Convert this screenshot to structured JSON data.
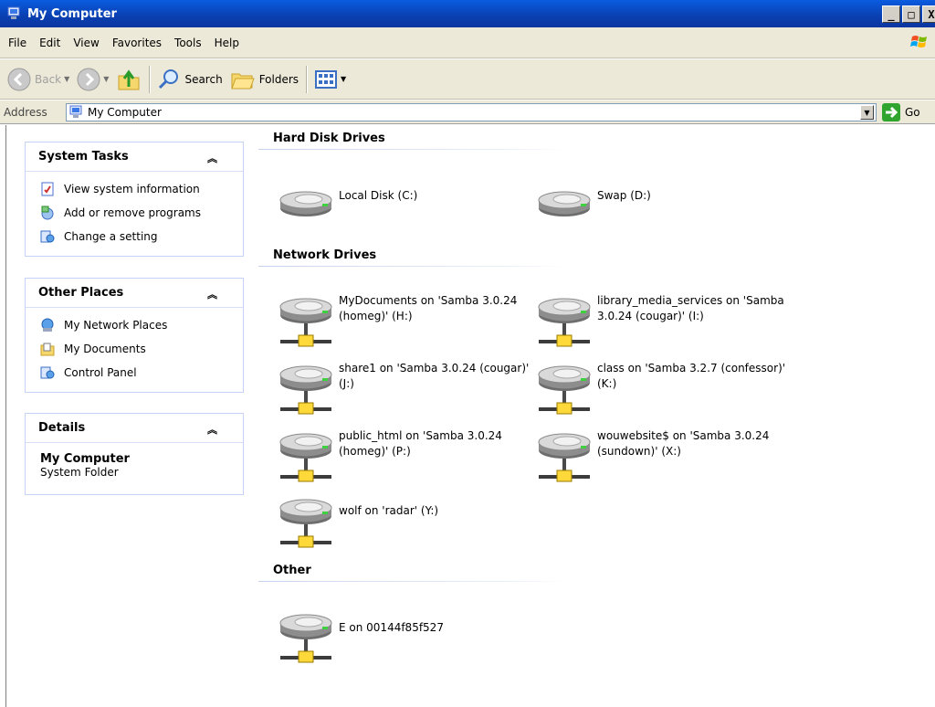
{
  "window": {
    "title": "My Computer",
    "buttons": [
      "_",
      "□",
      "X"
    ]
  },
  "menu": [
    "File",
    "Edit",
    "View",
    "Favorites",
    "Tools",
    "Help"
  ],
  "toolbar": {
    "back_label": "Back",
    "search_label": "Search",
    "folders_label": "Folders"
  },
  "address": {
    "label": "Address",
    "value": "My Computer",
    "go_label": "Go"
  },
  "panels": {
    "system_tasks": {
      "title": "System Tasks",
      "items": [
        "View system information",
        "Add or remove programs",
        "Change a setting"
      ]
    },
    "other_places": {
      "title": "Other Places",
      "items": [
        "My Network Places",
        "My Documents",
        "Control Panel"
      ]
    },
    "details": {
      "title": "Details",
      "name": "My Computer",
      "subtitle": "System Folder"
    }
  },
  "groups": {
    "hard_disk": {
      "title": "Hard Disk Drives",
      "items": [
        "Local Disk (C:)",
        "Swap (D:)"
      ]
    },
    "network": {
      "title": "Network Drives",
      "items": [
        "MyDocuments on 'Samba 3.0.24 (homeg)' (H:)",
        "library_media_services on 'Samba 3.0.24 (cougar)' (I:)",
        "share1 on 'Samba 3.0.24 (cougar)' (J:)",
        "class on 'Samba 3.2.7 (confessor)' (K:)",
        "public_html on 'Samba 3.0.24 (homeg)' (P:)",
        "wouwebsite$ on 'Samba 3.0.24 (sundown)' (X:)",
        "wolf on 'radar' (Y:)"
      ]
    },
    "other": {
      "title": "Other",
      "items": [
        "E on 00144f85f527"
      ]
    }
  },
  "colors": {
    "titlebar": "#0a4fd0",
    "chrome": "#ece9d8",
    "panel_border": "#c6d3f7"
  }
}
